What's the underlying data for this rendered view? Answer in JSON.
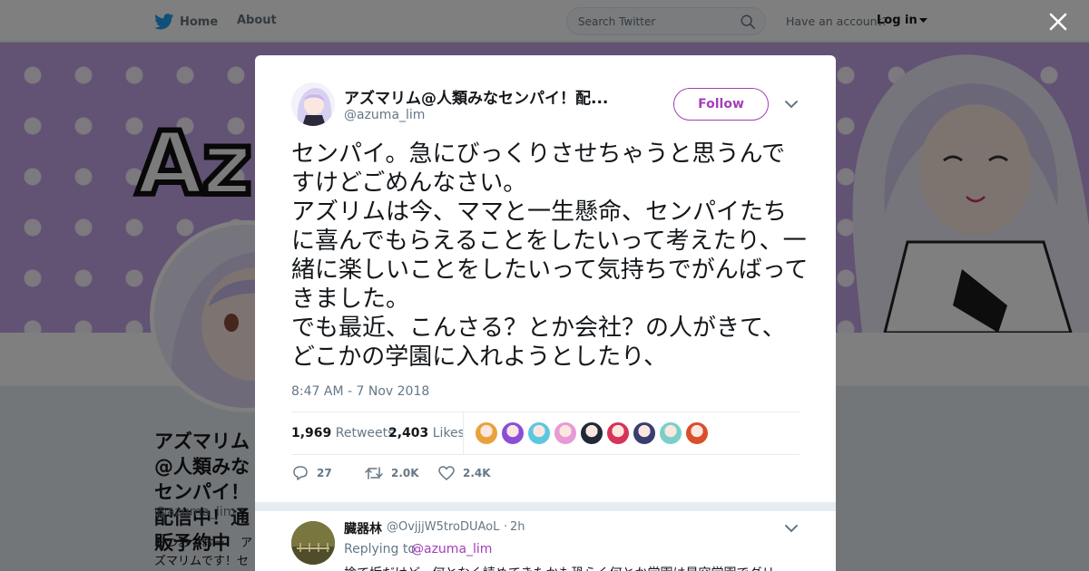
{
  "nav": {
    "home_label": "Home",
    "about_label": "About",
    "search_placeholder": "Search Twitter",
    "account_prompt": "Have an account?",
    "login_label": "Log in",
    "brand_color": "#1da1f2"
  },
  "profile": {
    "banner_text": "Az",
    "name": "アズマリム@人類みなセンパイ！配信中！通販予約中",
    "handle": "@azuma_lim",
    "bio": "おつおつおー！ アズマリムです！センパイたちとた"
  },
  "tweet": {
    "author_name": "アズマリム@人類みなセンパイ！配...",
    "author_handle": "@azuma_lim",
    "follow_label": "Follow",
    "text": "センパイ。急にびっくりさせちゃうと思うんですけどごめんなさい。\nアズリムは今、ママと一生懸命、センパイたちに喜んでもらえることをしたいって考えたり、一緒に楽しいことをしたいって気持ちでがんばってきました。\nでも最近、こんさる？とか会社？の人がきて、どこかの学園に入れようとしたり、",
    "timestamp": "8:47 AM - 7 Nov 2018",
    "retweets_count": "1,969",
    "retweets_label": "Retweets",
    "likes_count": "2,403",
    "likes_label": "Likes",
    "liker_colors": [
      "#e8a23c",
      "#8b4fd6",
      "#5cc7e0",
      "#e79ad6",
      "#1f2a36",
      "#d6345a",
      "#3a3e6e",
      "#7ad0c8",
      "#d94f2b"
    ],
    "actions": {
      "reply_count": "27",
      "retweet_count": "2.0K",
      "like_count": "2.4K"
    },
    "accent_color": "#a33fb8"
  },
  "reply": {
    "name": "臓器林",
    "handle": "@OvjjjW5troDUAoL",
    "separator": "·",
    "time": "2h",
    "replying_label": "Replying to",
    "replying_to": "@azuma_lim",
    "text": "捨て垢だけど、何となく読めてきたかも恐らく何とか学園は星空学園でグリー"
  }
}
